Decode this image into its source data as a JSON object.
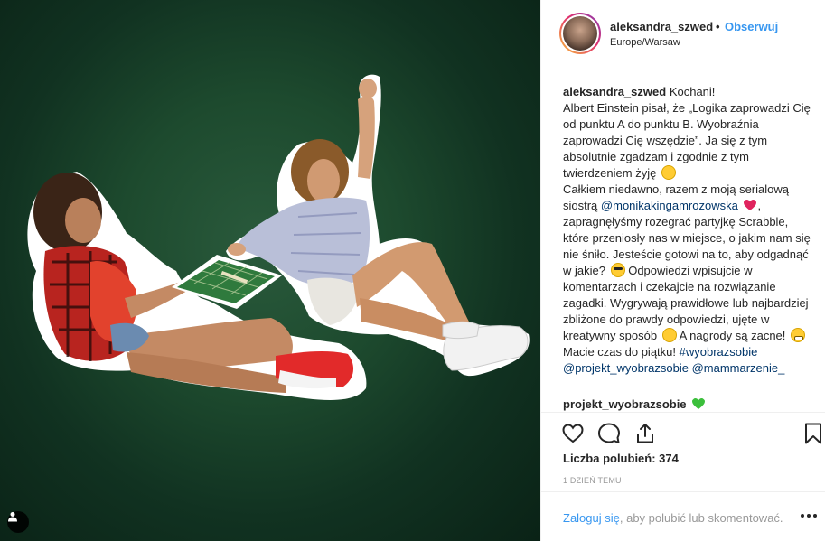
{
  "post": {
    "username": "aleksandra_szwed",
    "follow_label": "Obserwuj",
    "separator": "•",
    "location": "Europe/Warsaw"
  },
  "caption": {
    "username": "aleksandra_szwed",
    "line1": "Kochani!",
    "p1": "Albert Einstein pisał, że „Logika zaprowadzi Cię od punktu A do punktu B. Wyobraźnia zaprowadzi Cię wszędzie”. Ja się z tym absolutnie zgadzam i zgodnie z tym twierdzeniem żyję",
    "p2a": "Całkiem niedawno, razem z moją serialową siostrą",
    "mention1": "@monikakingamrozowska",
    "p2b": ", zapragnęłyśmy rozegrać partyjkę Scrabble, które przeniosły nas w miejsce, o jakim nam się nie śniło. Jesteście gotowi na to, aby odgadnąć w jakie?",
    "p3a": "Odpowiedzi wpisujcie w komentarzach i czekajcie na rozwiązanie zagadki. Wygrywają prawidłowe lub najbardziej zbliżone do prawdy odpowiedzi, ujęte w kreatywny sposób",
    "p3b": "A nagrody są zacne!",
    "p3c": "Macie czas do piątku!",
    "hashtag": "#wyobrazsobie",
    "mention2": "@projekt_wyobrazsobie",
    "mention3": "@mammarzenie_"
  },
  "comment": {
    "username": "projekt_wyobrazsobie"
  },
  "stats": {
    "likes_label": "Liczba polubień: 374",
    "time": "1 DZIEŃ TEMU"
  },
  "footer": {
    "login": "Zaloguj się",
    "rest": ", aby polubić lub skomentować."
  },
  "colors": {
    "link_blue": "#3897f0",
    "mention_dark": "#003569",
    "background_green": "#1d4a2e"
  },
  "icons": [
    "user-tag-icon",
    "heart-icon",
    "comment-icon",
    "share-icon",
    "bookmark-icon",
    "more-icon"
  ]
}
